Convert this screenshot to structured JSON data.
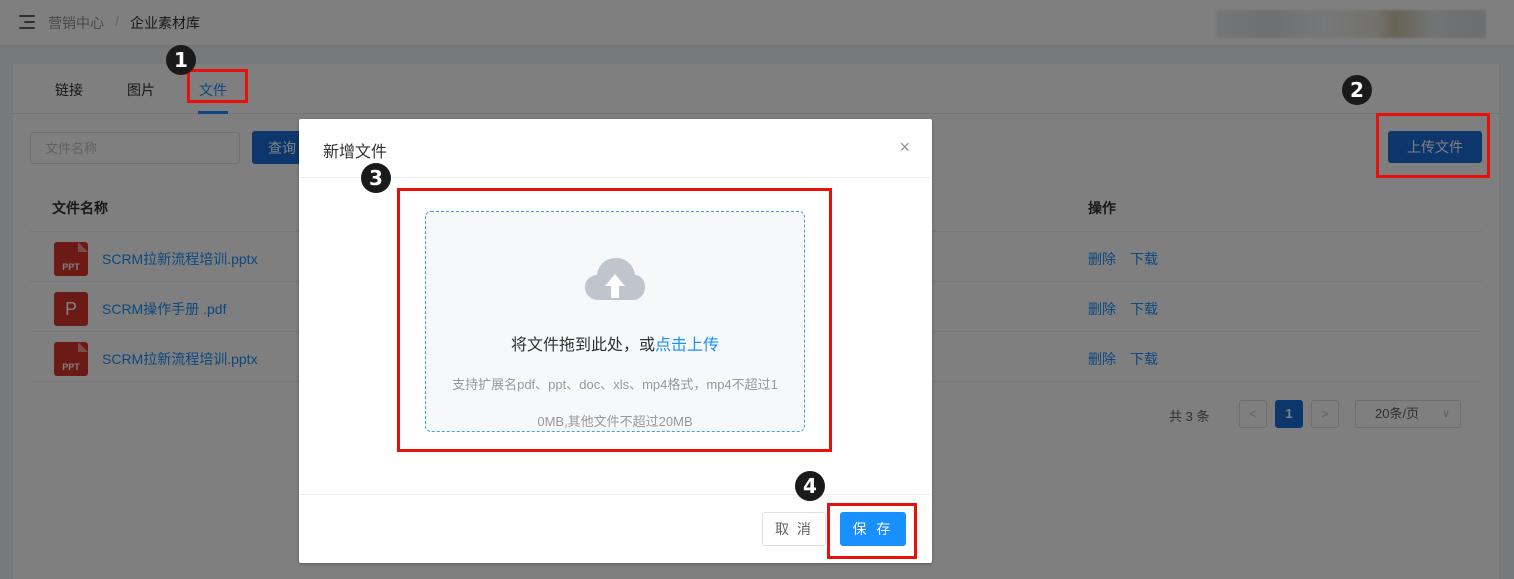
{
  "breadcrumb": {
    "parent": "营销中心",
    "separator": "/",
    "current": "企业素材库"
  },
  "tabs": [
    {
      "label": "链接"
    },
    {
      "label": "图片"
    },
    {
      "label": "文件"
    }
  ],
  "active_tab": "文件",
  "search": {
    "placeholder": "文件名称",
    "value": "",
    "query_label": "查询"
  },
  "upload_button_label": "上传文件",
  "table": {
    "columns": {
      "name": "文件名称",
      "operations": "操作"
    },
    "rows": [
      {
        "icon_text": "PPT",
        "name": "SCRM拉新流程培训.pptx",
        "actions": {
          "delete": "删除",
          "download": "下载"
        }
      },
      {
        "icon_text": "P",
        "name": "SCRM操作手册 .pdf",
        "actions": {
          "delete": "删除",
          "download": "下载"
        }
      },
      {
        "icon_text": "PPT",
        "name": "SCRM拉新流程培训.pptx",
        "actions": {
          "delete": "删除",
          "download": "下载"
        }
      }
    ]
  },
  "pagination": {
    "total_text": "共 3 条",
    "prev": "<",
    "current_page": "1",
    "next": ">",
    "page_size": "20条/页",
    "page_size_chevron": "∨"
  },
  "dialog": {
    "title": "新增文件",
    "close": "×",
    "dropzone": {
      "text": "将文件拖到此处，或",
      "link": "点击上传",
      "hint_line1": "支持扩展名pdf、ppt、doc、xls、mp4格式，mp4不超过1",
      "hint_line2": "0MB,其他文件不超过20MB"
    },
    "cancel_label": "取 消",
    "save_label": "保 存"
  },
  "annotations": [
    {
      "number": "❶"
    },
    {
      "number": "❷"
    },
    {
      "number": "❸"
    },
    {
      "number": "❹"
    }
  ],
  "colors": {
    "primary": "#1890ff",
    "button_blue": "#1a6fd8",
    "highlight_red": "#e8100a",
    "file_icon_red": "#d9342b"
  }
}
